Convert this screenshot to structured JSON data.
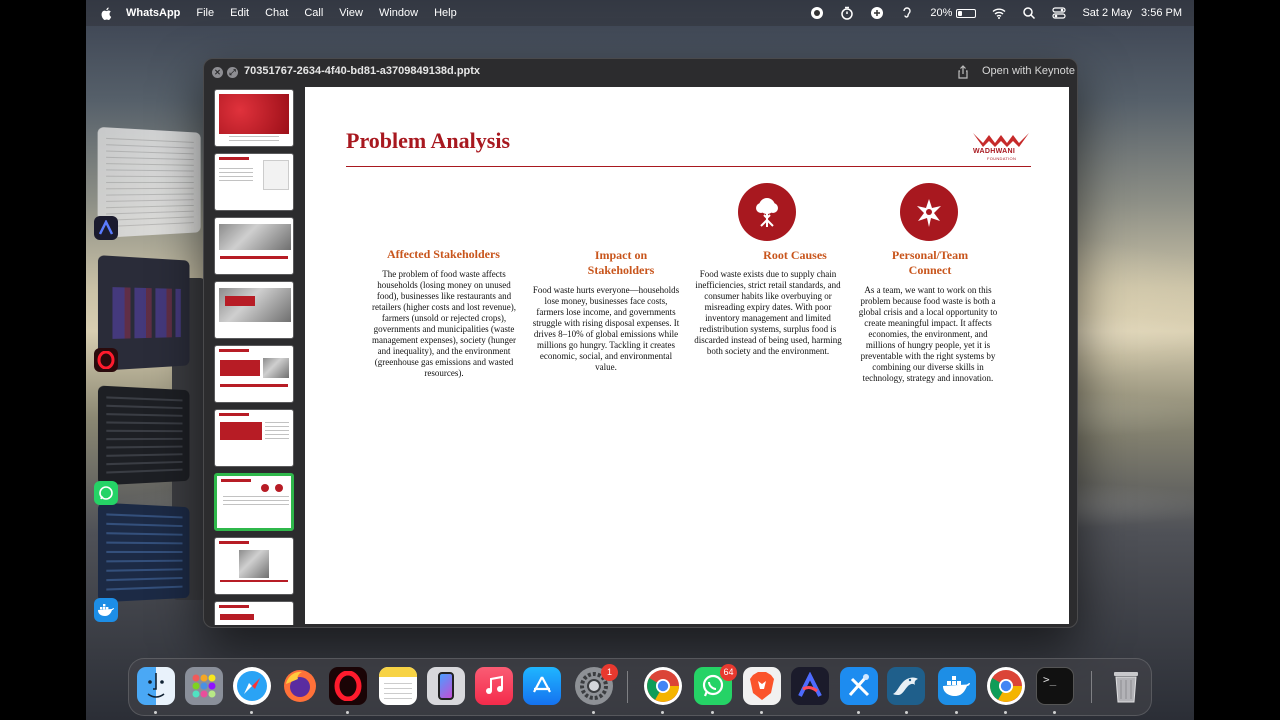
{
  "menubar": {
    "app_name": "WhatsApp",
    "menus": [
      "File",
      "Edit",
      "Chat",
      "Call",
      "View",
      "Window",
      "Help"
    ],
    "battery_percent": "20%",
    "battery_level": 0.2,
    "date": "Sat 2 May",
    "time": "3:56 PM"
  },
  "window": {
    "title": "70351767-2634-4f40-bd81-a3709849138d.pptx",
    "open_with_label": "Open with Keynote"
  },
  "slide": {
    "title": "Problem Analysis",
    "logo": {
      "name": "WADHWANI",
      "sub": "FOUNDATION"
    },
    "columns": [
      {
        "heading": "Affected Stakeholders",
        "body": "The problem of food waste affects households (losing money on unused food), businesses like restaurants and retailers (higher costs and lost revenue), farmers (unsold or rejected crops), governments and municipalities (waste management expenses), society (hunger and inequality), and the environment (greenhouse gas emissions and wasted resources)."
      },
      {
        "heading": "Impact on Stakeholders",
        "body": "Food waste hurts everyone—households lose money, businesses face costs, farmers lose income, and governments struggle with rising disposal expenses. It drives 8–10% of global emissions while millions go hungry. Tackling it creates economic, social, and environmental value."
      },
      {
        "heading": "Root Causes",
        "body": "Food waste exists due to supply chain inefficiencies, strict retail standards, and consumer habits like overbuying or misreading expiry dates. With poor inventory management and limited redistribution systems, surplus food is discarded instead of being used, harming both society and the environment."
      },
      {
        "heading": "Personal/Team Connect",
        "body": "As a team, we want to work on this problem because food waste is both a global crisis and a local opportunity to create meaningful impact. It affects economies, the environment, and millions of hungry people, yet it is preventable with the right systems by combining our diverse skills in technology, strategy and innovation."
      }
    ]
  },
  "sidebar": {
    "active_index": 6,
    "thumb_count": 9
  },
  "dock": {
    "apps": [
      {
        "name": "Finder",
        "icon": "finder-icon"
      },
      {
        "name": "Launchpad",
        "icon": "launchpad-icon"
      },
      {
        "name": "Safari",
        "icon": "safari-icon"
      },
      {
        "name": "Firefox",
        "icon": "firefox-icon"
      },
      {
        "name": "Opera",
        "icon": "opera-icon"
      },
      {
        "name": "Notes",
        "icon": "notes-icon"
      },
      {
        "name": "iPhone Mirroring",
        "icon": "iphone-mirroring-icon"
      },
      {
        "name": "Music",
        "icon": "music-icon"
      },
      {
        "name": "App Store",
        "icon": "app-store-icon"
      },
      {
        "name": "System Settings",
        "icon": "settings-icon",
        "badge": "1"
      },
      {
        "name": "Chrome",
        "icon": "chrome-icon"
      },
      {
        "name": "WhatsApp",
        "icon": "whatsapp-icon",
        "badge": "64"
      },
      {
        "name": "Brave",
        "icon": "brave-icon"
      },
      {
        "name": "Arc",
        "icon": "arc-icon"
      },
      {
        "name": "Xcode",
        "icon": "xcode-icon"
      },
      {
        "name": "MySQL Workbench",
        "icon": "mysql-icon"
      },
      {
        "name": "Docker",
        "icon": "docker-icon"
      },
      {
        "name": "Chrome",
        "icon": "chrome-icon"
      },
      {
        "name": "Terminal",
        "icon": "terminal-icon"
      },
      {
        "name": "Trash",
        "icon": "trash-icon"
      }
    ]
  },
  "colors": {
    "slide_accent": "#a8181f",
    "heading_orange": "#c8551c",
    "active_thumb": "#2fb84b"
  }
}
